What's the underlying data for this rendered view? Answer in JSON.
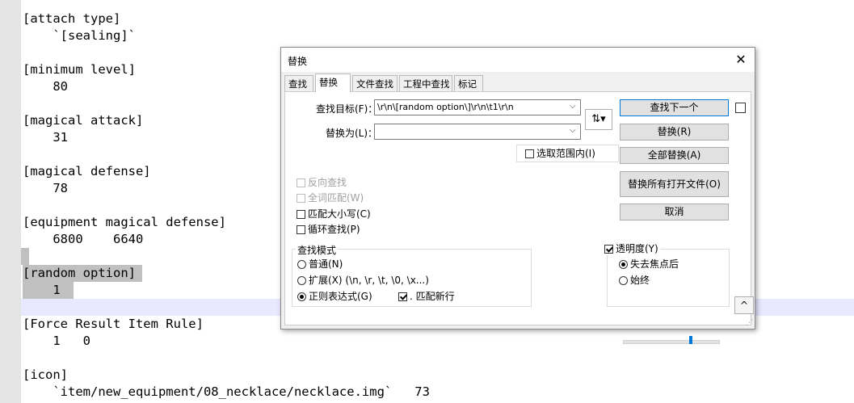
{
  "editor": {
    "lines": [
      "[attach type]",
      "    `[sealing]`",
      "",
      "[minimum level]",
      "    80",
      "",
      "[magical attack]",
      "    31",
      "",
      "[magical defense]",
      "    78",
      "",
      "[equipment magical defense]",
      "    6800    6640",
      "",
      "[random option]",
      "    1",
      "",
      "[Force Result Item Rule]",
      "    1   0",
      "",
      "[icon]",
      "    `item/new_equipment/08_necklace/necklace.img`   73"
    ]
  },
  "dialog": {
    "title": "替换",
    "tabs": [
      "查找",
      "替换",
      "文件查找",
      "工程中查找",
      "标记"
    ],
    "active_tab": "替换",
    "find_label": "查找目标(F)：",
    "find_value": "\\r\\n\\[random option\\]\\r\\n\\t1\\r\\n",
    "replace_label": "替换为(L)：",
    "replace_value": "",
    "buttons": {
      "find_next": "查找下一个",
      "replace": "替换(R)",
      "replace_all": "全部替换(A)",
      "replace_all_open": "替换所有打开文件(O)",
      "cancel": "取消"
    },
    "in_selection": "选取范围内(I)",
    "options": {
      "backward": "反向查找",
      "whole_word": "全词匹配(W)",
      "match_case": "匹配大小写(C)",
      "wrap": "循环查找(P)"
    },
    "search_mode": {
      "title": "查找模式",
      "normal": "普通(N)",
      "extended": "扩展(X) (\\n, \\r, \\t, \\0, \\x...)",
      "regex": "正则表达式(G)",
      "dot_newline": ". 匹配新行"
    },
    "transparency": {
      "title": "透明度(Y)",
      "on_lose_focus": "失去焦点后",
      "always": "始终"
    }
  }
}
